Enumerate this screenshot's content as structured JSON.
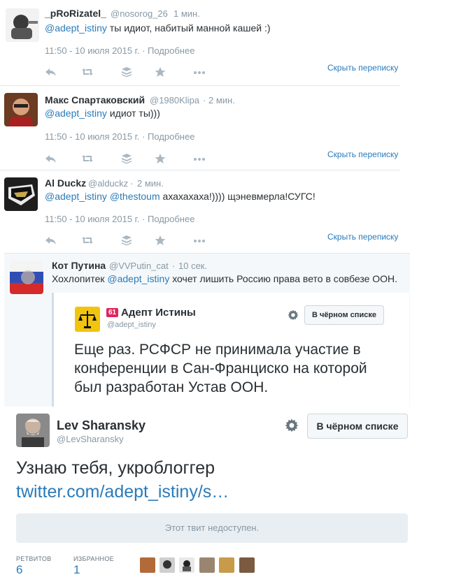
{
  "tweets": [
    {
      "name": "_pRoRizatel_",
      "handle": "@nosorog_26",
      "time": "1 мин.",
      "text_mention": "@adept_istiny",
      "text_rest": " ты идиот, набитый манной кашей :)",
      "meta_time": "11:50 - 10 июля 2015 г.",
      "meta_more": "Подробнее",
      "hide": "Скрыть переписку"
    },
    {
      "name": "Макс Спартаковский",
      "handle": "@1980Klipa",
      "time": "2 мин.",
      "text_mention": "@adept_istiny",
      "text_rest": " идиот ты)))",
      "meta_time": "11:50 - 10 июля 2015 г.",
      "meta_more": "Подробнее",
      "hide": "Скрыть переписку"
    },
    {
      "name": "Al Duckz",
      "handle": "@alduckz",
      "time": "2 мин.",
      "text_mention": "@adept_istiny",
      "text_mention2": "@thestoum",
      "text_rest": " ахахахаха!)))) щэневмерла!СУГС!",
      "meta_time": "11:50 - 10 июля 2015 г.",
      "meta_more": "Подробнее",
      "hide": "Скрыть переписку"
    }
  ],
  "quote_tweet": {
    "name": "Кот Путина",
    "handle": "@VVPutin_cat",
    "time": "10 сек.",
    "text_pre": "Хохлопитек ",
    "text_mention": "@adept_istiny",
    "text_rest": " хочет лишить Россию права вето в совбезе ООН.",
    "embedded": {
      "badge": "61",
      "name": "Адепт Истины",
      "handle": "@adept_istiny",
      "blacklist_label": "В чёрном списке",
      "text": "Еще раз. РСФСР не принимала участие в конференции в Сан-Франциско на которой был разработан Устав ООН."
    }
  },
  "main_tweet": {
    "name": "Lev Sharansky",
    "handle": "@LevSharansky",
    "blacklist_label": "В чёрном списке",
    "text": "Узнаю тебя, укроблоггер",
    "link": "twitter.com/adept_istiny/s…",
    "unavailable": "Этот твит недоступен.",
    "retweets_label": "РЕТВИТОВ",
    "retweets_count": "6",
    "favorites_label": "ИЗБРАННОЕ",
    "favorites_count": "1"
  },
  "colors": {
    "link": "#2b7bb9",
    "muted": "#8899a6",
    "border": "#e1e8ed",
    "text": "#292f33"
  }
}
